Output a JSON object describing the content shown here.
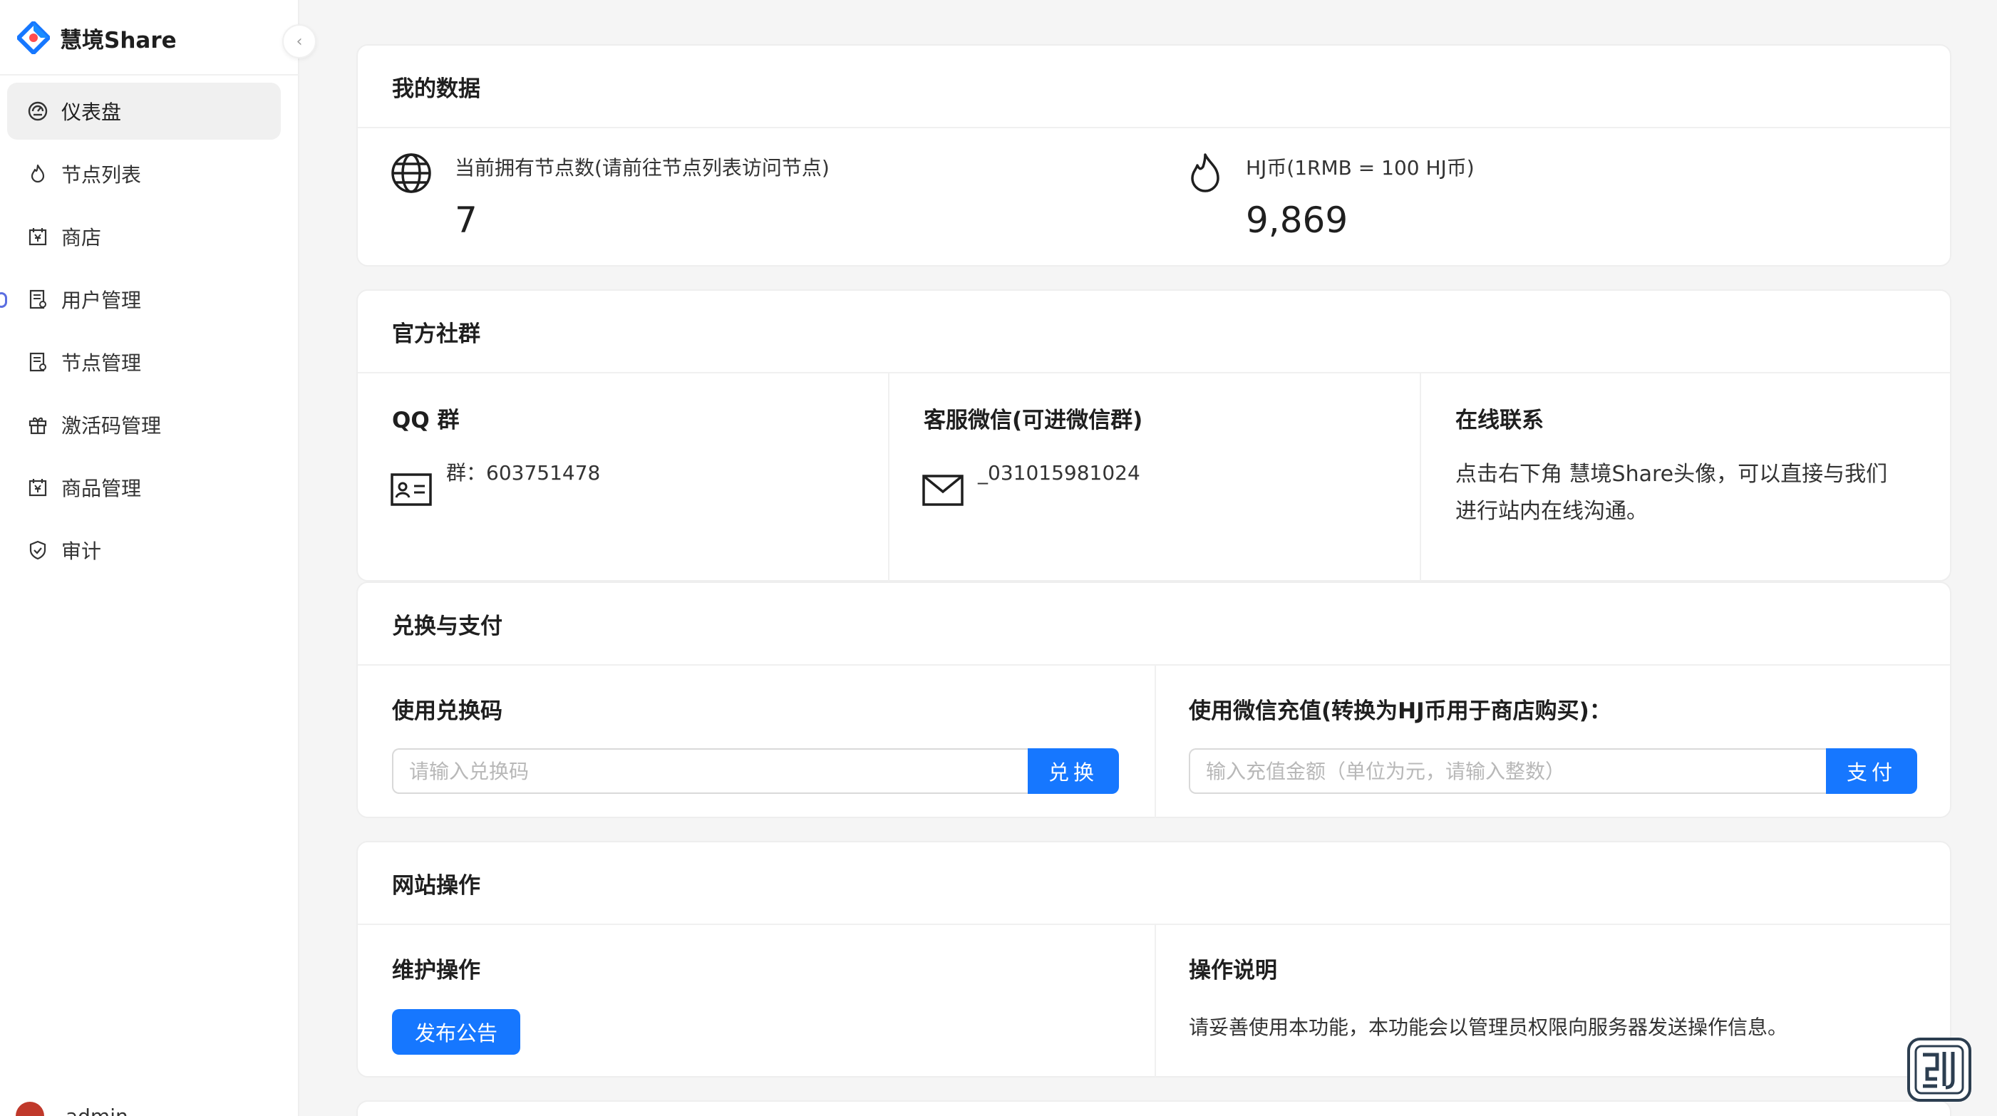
{
  "app": {
    "name": "慧境Share"
  },
  "sidebar": {
    "items": [
      {
        "label": "仪表盘",
        "icon": "dashboard-icon",
        "active": true
      },
      {
        "label": "节点列表",
        "icon": "fire-icon"
      },
      {
        "label": "商店",
        "icon": "shop-icon"
      },
      {
        "label": "用户管理",
        "icon": "profile-icon"
      },
      {
        "label": "节点管理",
        "icon": "profile-icon"
      },
      {
        "label": "激活码管理",
        "icon": "gift-icon"
      },
      {
        "label": "商品管理",
        "icon": "shop-icon"
      },
      {
        "label": "审计",
        "icon": "safety-icon"
      }
    ],
    "user": {
      "name": "admin"
    }
  },
  "my_data": {
    "title": "我的数据",
    "nodes": {
      "label": "当前拥有节点数(请前往节点列表访问节点)",
      "value": "7"
    },
    "coins": {
      "label": "HJ币(1RMB = 100 HJ币)",
      "value": "9,869"
    }
  },
  "community": {
    "title": "官方社群",
    "qq": {
      "title": "QQ 群",
      "text": "群：603751478"
    },
    "wechat": {
      "title": "客服微信(可进微信群)",
      "text": "_031015981024"
    },
    "online": {
      "title": "在线联系",
      "line1": "点击右下角 慧境Share头像，可以直接与我们",
      "line2": "进行站内在线沟通。"
    }
  },
  "exchange": {
    "title": "兑换与支付",
    "redeem": {
      "title": "使用兑换码",
      "placeholder": "请输入兑换码",
      "button": "兑换"
    },
    "recharge": {
      "title": "使用微信充值(转换为HJ币用于商店购买)：",
      "placeholder": "输入充值金额（单位为元，请输入整数）",
      "button": "支付"
    }
  },
  "site_ops": {
    "title": "网站操作",
    "maintenance": {
      "title": "维护操作",
      "button": "发布公告"
    },
    "instructions": {
      "title": "操作说明",
      "text": "请妥善使用本功能，本功能会以管理员权限向服务器发送操作信息。"
    }
  },
  "colors": {
    "primary": "#1677ff",
    "active_bg": "#f0f0f0"
  }
}
